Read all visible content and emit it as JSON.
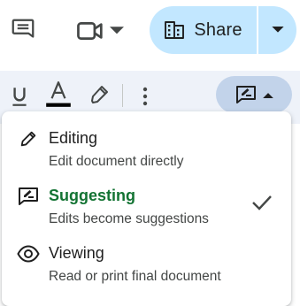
{
  "topbar": {
    "comments_icon": "comment-icon",
    "meet_icon": "videocam-icon",
    "meet_dropdown_icon": "caret-down-icon",
    "share": {
      "label": "Share",
      "icon": "domain-icon",
      "dropdown_icon": "caret-down-icon"
    }
  },
  "toolbar": {
    "underline_icon": "underline-icon",
    "text_color_icon": "text-color-icon",
    "highlight_icon": "highlighter-icon",
    "more_icon": "more-vert-icon",
    "mode_button": {
      "icon": "rate-review-icon",
      "dropdown_icon": "caret-up-icon"
    }
  },
  "menu": {
    "items": [
      {
        "title": "Editing",
        "subtitle": "Edit document directly",
        "icon": "pencil-icon",
        "selected": false
      },
      {
        "title": "Suggesting",
        "subtitle": "Edits become suggestions",
        "icon": "rate-review-icon",
        "selected": true
      },
      {
        "title": "Viewing",
        "subtitle": "Read or print final document",
        "icon": "eye-icon",
        "selected": false
      }
    ],
    "check_icon": "check-icon"
  },
  "colors": {
    "share_bg": "#c2e7ff",
    "toolbar_bg": "#eef2f9",
    "mode_button_bg": "#c2d3ea",
    "active_green": "#137333",
    "text_color_underline": "#000000"
  }
}
